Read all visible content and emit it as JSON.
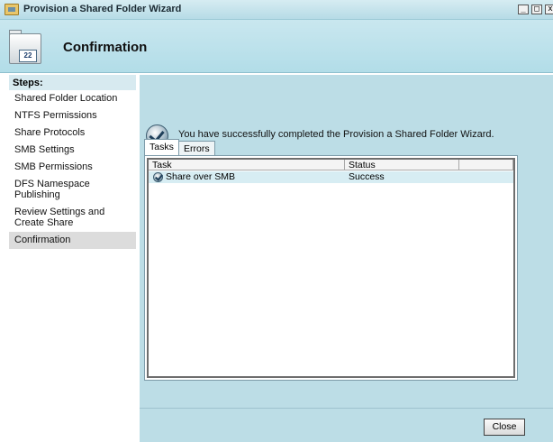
{
  "window": {
    "title": "Provision a Shared Folder Wizard",
    "controls": {
      "minimize": "_",
      "maximize": "□",
      "close": "x"
    }
  },
  "header": {
    "title": "Confirmation",
    "icon": "shared-folder-wizard-icon"
  },
  "steps": {
    "heading": "Steps:",
    "items": [
      {
        "label": "Shared Folder Location",
        "selected": false
      },
      {
        "label": "NTFS Permissions",
        "selected": false
      },
      {
        "label": "Share Protocols",
        "selected": false
      },
      {
        "label": "SMB Settings",
        "selected": false
      },
      {
        "label": "SMB Permissions",
        "selected": false
      },
      {
        "label": "DFS Namespace Publishing",
        "selected": false
      },
      {
        "label": "Review Settings and Create Share",
        "selected": false
      },
      {
        "label": "Confirmation",
        "selected": true
      }
    ]
  },
  "main": {
    "success_message": "You have successfully completed the Provision a Shared Folder Wizard.",
    "tabs": [
      {
        "label": "Tasks",
        "active": true
      },
      {
        "label": "Errors",
        "active": false
      }
    ],
    "table": {
      "columns": [
        "Task",
        "Status",
        ""
      ],
      "rows": [
        {
          "task": "Share over SMB",
          "status": "Success",
          "icon": "success-check-icon"
        }
      ]
    }
  },
  "footer": {
    "close_label": "Close"
  },
  "colors": {
    "title_bar": "#c9e7ef",
    "content_bg": "#bcdde6",
    "selected_step_bg": "#dcdcdc",
    "selected_row_bg": "#d7edf3"
  }
}
